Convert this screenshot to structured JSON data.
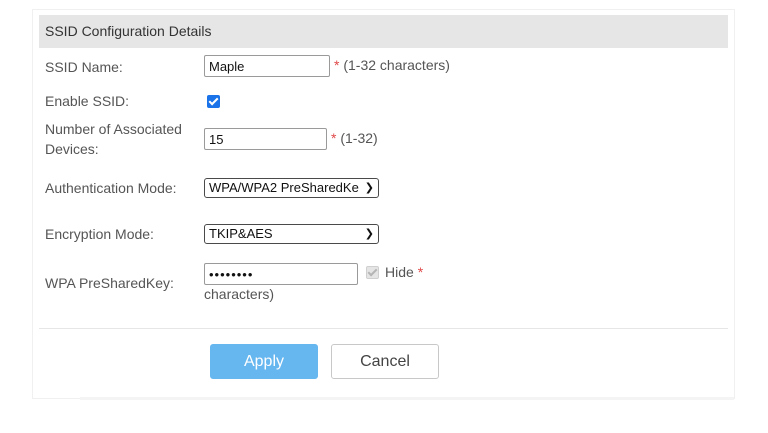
{
  "panel": {
    "title": "SSID Configuration Details"
  },
  "form": {
    "ssid_name": {
      "label": "SSID Name:",
      "value": "Maple",
      "required_mark": "*",
      "hint": "(1-32 characters)"
    },
    "enable_ssid": {
      "label": "Enable SSID:",
      "checked": true
    },
    "associated_devices": {
      "label_line1": "Number of Associated",
      "label_line2": "Devices:",
      "value": "15",
      "required_mark": "*",
      "hint": "(1-32)"
    },
    "authentication_mode": {
      "label": "Authentication Mode:",
      "selected": "WPA/WPA2 PreSharedKe"
    },
    "encryption_mode": {
      "label": "Encryption Mode:",
      "selected": "TKIP&AES"
    },
    "wpa_key": {
      "label": "WPA PreSharedKey:",
      "masked_value": "••••••••",
      "hide_label": "Hide",
      "hide_checked": true,
      "required_mark": "*",
      "hint_tail": "characters)"
    }
  },
  "actions": {
    "apply_label": "Apply",
    "cancel_label": "Cancel"
  },
  "colors": {
    "accent": "#1a73e8",
    "apply_button": "#66b6f0",
    "required_star": "#e04848",
    "header_bg": "#e6e6e6"
  },
  "icons": {
    "enable_ssid_checkbox": "checkbox-checked-icon",
    "hide_checkbox": "checkbox-checked-disabled-icon",
    "select_arrow": "chevron-down-icon"
  }
}
